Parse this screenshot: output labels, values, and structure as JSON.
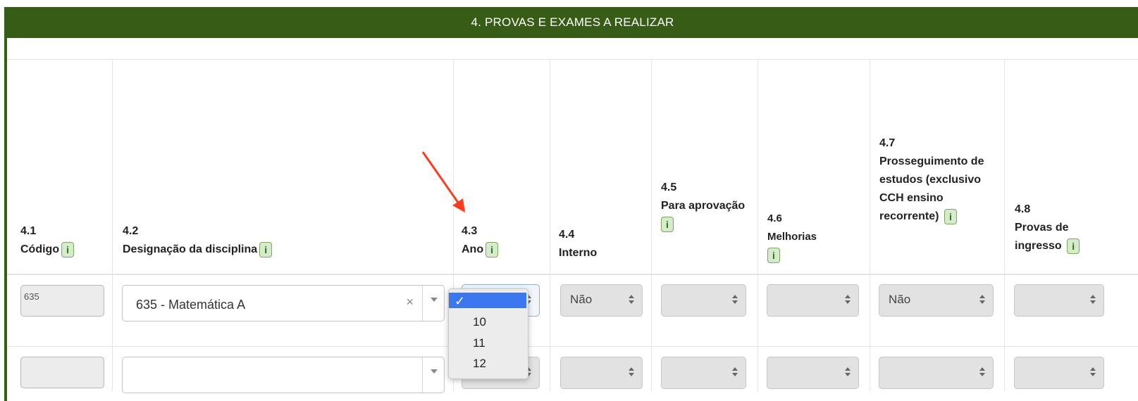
{
  "section": {
    "title": "4. PROVAS E EXAMES A REALIZAR"
  },
  "columns": [
    {
      "num": "4.1",
      "label": "Código"
    },
    {
      "num": "4.2",
      "label": "Designação da disciplina"
    },
    {
      "num": "4.3",
      "label": "Ano"
    },
    {
      "num": "4.4",
      "label": "Interno"
    },
    {
      "num": "4.5",
      "label": "Para aprovação"
    },
    {
      "num": "4.6",
      "label": "Melhorias"
    },
    {
      "num": "4.7",
      "label": "Prosseguimento de estudos (exclusivo CCH ensino recorrente)"
    },
    {
      "num": "4.8",
      "label": "Provas de ingresso"
    }
  ],
  "info_icon_label": "i",
  "rows": [
    {
      "codigo": "635",
      "designacao": "635 - Matemática A",
      "interno": "Não",
      "prosseguimento": "Não"
    },
    {
      "codigo": "",
      "designacao": "",
      "interno": "",
      "prosseguimento": ""
    }
  ],
  "clear_symbol": "×",
  "ano_dropdown": {
    "selected_check": "✓",
    "options": [
      "10",
      "11",
      "12"
    ]
  },
  "colors": {
    "header_bg": "#375c15",
    "selected_option": "#3b78f0",
    "annotation_arrow": "#ff3b1f"
  }
}
